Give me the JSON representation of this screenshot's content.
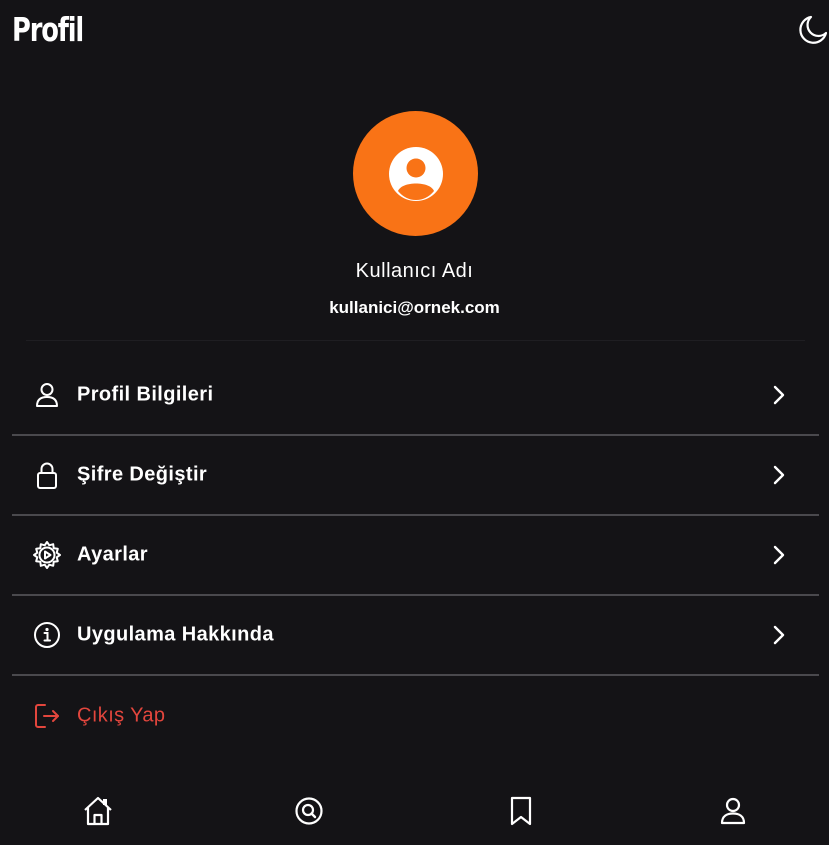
{
  "header": {
    "title": "Profil",
    "theme_toggle_icon": "moon-icon"
  },
  "profile": {
    "avatar_icon": "user-circle-icon",
    "avatar_color": "#f97316",
    "name": "Kullanıcı Adı",
    "email": "kullanici@ornek.com"
  },
  "menu": {
    "items": [
      {
        "label": "Profil Bilgileri",
        "icon": "user-icon"
      },
      {
        "label": "Şifre Değiştir",
        "icon": "lock-icon"
      },
      {
        "label": "Ayarlar",
        "icon": "gear-icon"
      },
      {
        "label": "Uygulama Hakkında",
        "icon": "info-icon"
      }
    ],
    "chevron_icon": "chevron-right-icon"
  },
  "logout": {
    "label": "Çıkış Yap",
    "icon": "logout-icon",
    "color": "#e3463d"
  },
  "bottom_nav": {
    "items": [
      {
        "icon": "home-icon"
      },
      {
        "icon": "search-icon"
      },
      {
        "icon": "bookmark-icon"
      },
      {
        "icon": "profile-icon"
      }
    ]
  },
  "colors": {
    "background": "#141316",
    "divider": "#4a494d",
    "text": "#ffffff"
  }
}
